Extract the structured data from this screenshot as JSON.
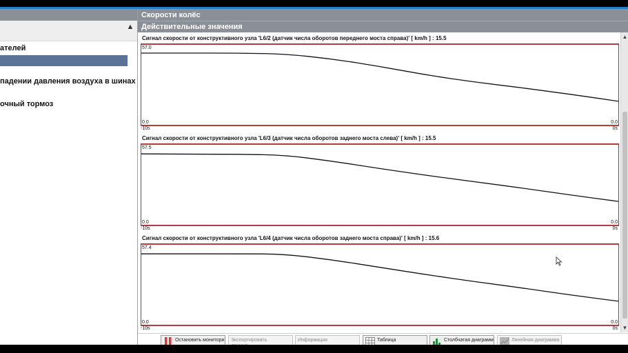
{
  "left_panel": {
    "items": [
      {
        "label": "ателей"
      },
      {
        "label": ""
      },
      {
        "label": "падении давления воздуха в шинах"
      },
      {
        "label": "очный тормоз"
      }
    ],
    "collapse_icon": "chevron-up-icon"
  },
  "header": {
    "title": "Скорости колёс",
    "subtitle": "Действительные значения"
  },
  "charts": [
    {
      "title": "Сигнал скорости от конструктивного узла 'L6/2 (датчик числа оборотов переднего моста справа)' [ km/h ] : 15.5",
      "y_max_label": "57.0",
      "y_min_label": "0.0",
      "y_min_label_right": "0.0",
      "x_left_label": "-10s",
      "x_right_label": "0s"
    },
    {
      "title": "Сигнал скорости от конструктивного узла 'L6/3 (датчик числа оборотов заднего моста слева)' [ km/h ] : 15.5",
      "y_max_label": "57.5",
      "y_min_label": "0.0",
      "y_min_label_right": "0.0",
      "x_left_label": "-10s",
      "x_right_label": "0s"
    },
    {
      "title": "Сигнал скорости от конструктивного узла 'L6/4 (датчик числа оборотов заднего моста справа)' [ km/h ] : 15.6",
      "y_max_label": "57.4",
      "y_min_label": "0.0",
      "y_min_label_right": "0.0",
      "x_left_label": "-10s",
      "x_right_label": "0s"
    }
  ],
  "chart_data": [
    {
      "type": "line",
      "title": "Сигнал скорости от конструктивного узла 'L6/2 (датчик числа оборотов переднего моста справа)' [ km/h ] : 15.5",
      "x": [
        -10,
        -9,
        -8,
        -7,
        -6,
        -5,
        -4,
        -3,
        -2,
        -1,
        0
      ],
      "series": [
        {
          "values": [
            57.0,
            57.0,
            57.0,
            56.3,
            52.0,
            45.5,
            38.0,
            32.0,
            27.0,
            21.5,
            15.5
          ]
        }
      ],
      "ylim": [
        0,
        57.0
      ],
      "xlim": [
        -10,
        0
      ]
    },
    {
      "type": "line",
      "title": "Сигнал скорости от конструктивного узла 'L6/3 (датчик числа оборотов заднего моста слева)' [ km/h ] : 15.5",
      "x": [
        -10,
        -9,
        -8,
        -7,
        -6,
        -5,
        -4,
        -3,
        -2,
        -1,
        0
      ],
      "series": [
        {
          "values": [
            56.8,
            56.5,
            56.5,
            55.8,
            50.5,
            44.0,
            38.0,
            32.5,
            27.0,
            21.0,
            15.5
          ]
        }
      ],
      "ylim": [
        0,
        57.5
      ],
      "xlim": [
        -10,
        0
      ]
    },
    {
      "type": "line",
      "title": "Сигнал скорости от конструктивного узла 'L6/4 (датчик числа оборотов заднего моста справа)' [ km/h ] : 15.6",
      "x": [
        -10,
        -9,
        -8,
        -7,
        -6,
        -5,
        -4,
        -3,
        -2,
        -1,
        0
      ],
      "series": [
        {
          "values": [
            56.7,
            56.7,
            56.7,
            56.5,
            51.5,
            45.0,
            38.5,
            32.5,
            27.0,
            21.0,
            15.6
          ]
        }
      ],
      "ylim": [
        0,
        57.4
      ],
      "xlim": [
        -10,
        0
      ]
    }
  ],
  "toolbar": {
    "stop_label": "Остановить мониторинг",
    "export_label": "Экспортировать данные.",
    "info_label": "Информация",
    "table_label": "Таблица",
    "bar_label": "Столбчатая диаграмма",
    "line_label": "Линейная диаграмма",
    "stop_color": "#d83a3a",
    "bar_icon_color": "#2a8a4a"
  },
  "colors": {
    "accent": "#1e7fd0",
    "header_bg": "#8a8f98",
    "selected_item": "#5b7396",
    "threshold_line": "#b43c3c"
  }
}
